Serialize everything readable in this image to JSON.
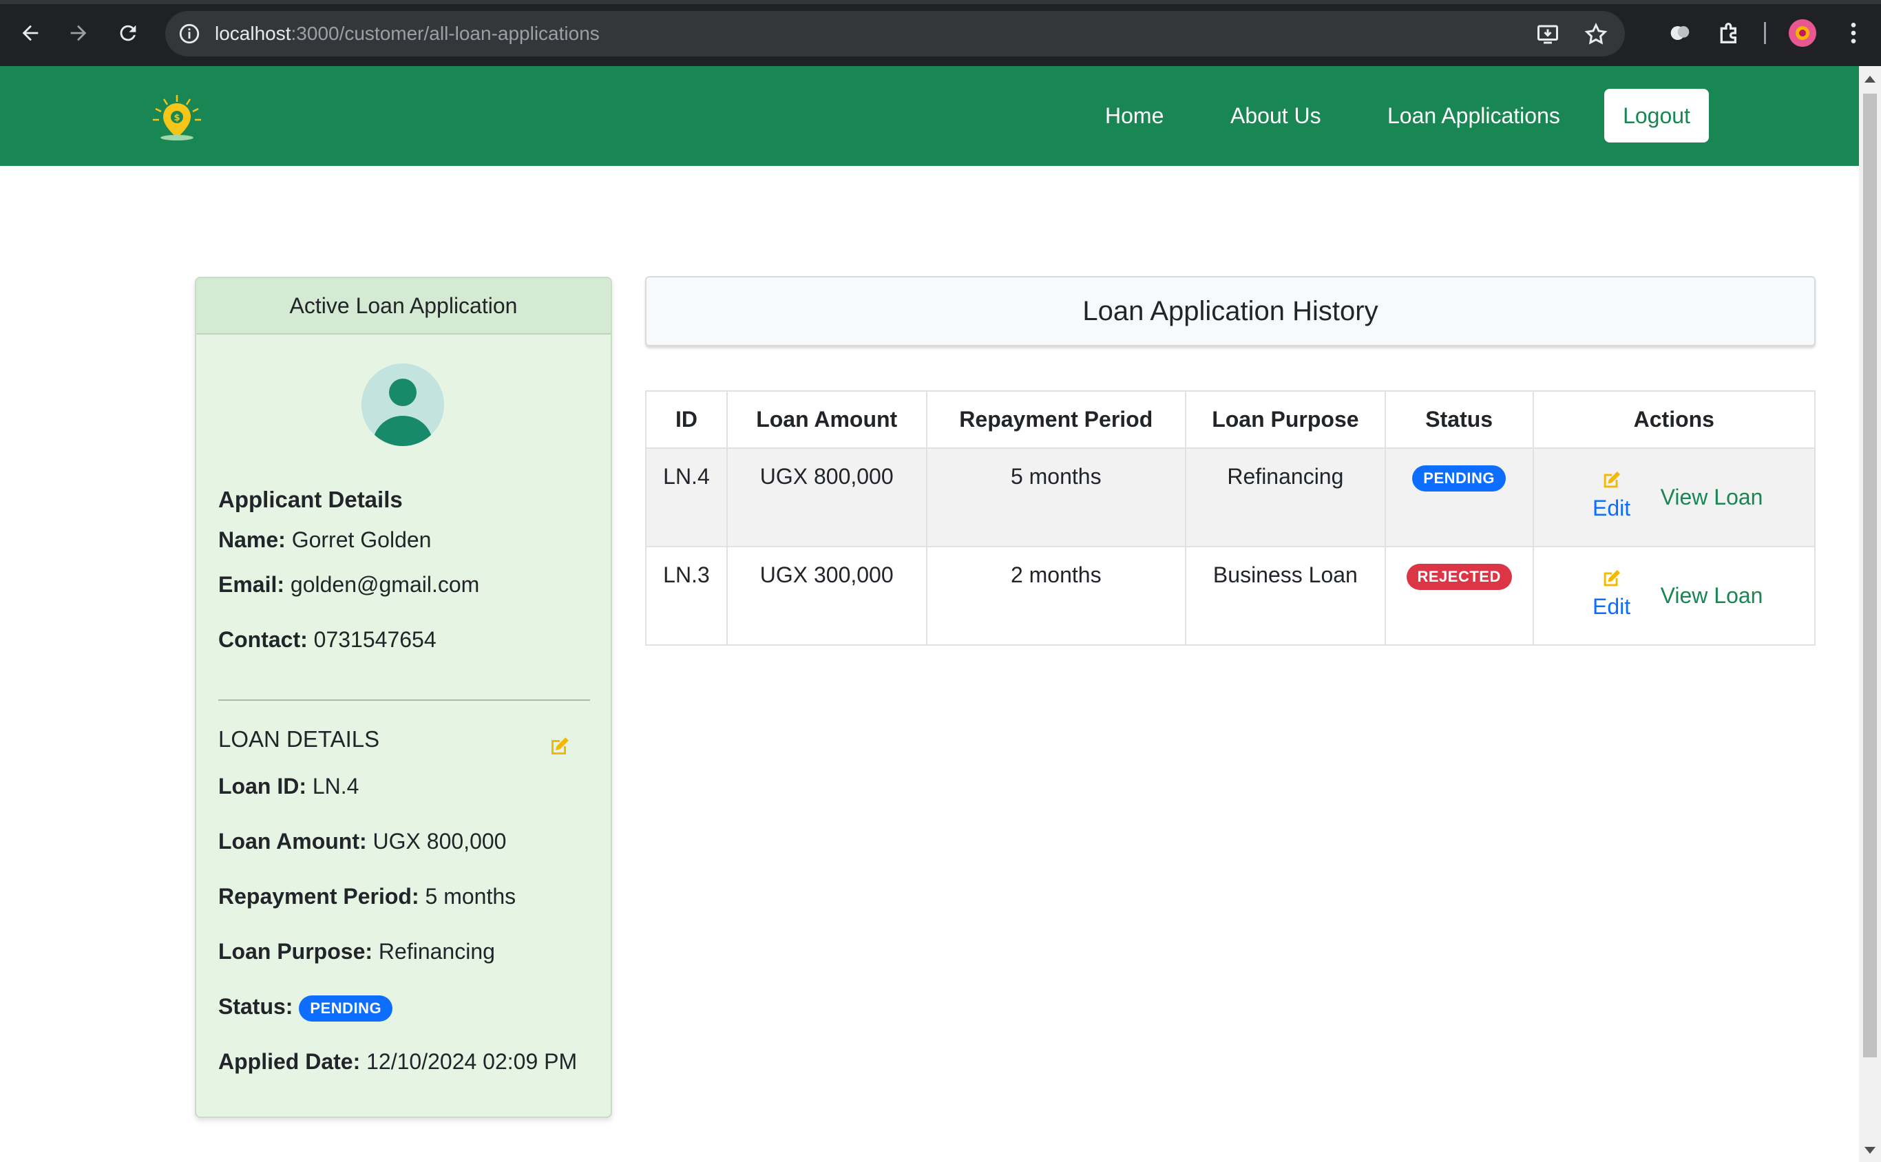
{
  "browser": {
    "url_host": "localhost",
    "url_path": ":3000/customer/all-loan-applications"
  },
  "navbar": {
    "links": [
      "Home",
      "About Us",
      "Loan Applications"
    ],
    "logout_label": "Logout",
    "bg_color": "#198754"
  },
  "active_card": {
    "header": "Active Loan Application",
    "applicant_heading": "Applicant Details",
    "name_label": "Name:",
    "name_value": "Gorret Golden",
    "email_label": "Email:",
    "email_value": "golden@gmail.com",
    "contact_label": "Contact:",
    "contact_value": "0731547654",
    "loan_heading": "LOAN DETAILS",
    "loan_id_label": "Loan ID:",
    "loan_id_value": "LN.4",
    "amount_label": "Loan Amount:",
    "amount_value": "UGX 800,000",
    "period_label": "Repayment Period:",
    "period_value": "5 months",
    "purpose_label": "Loan Purpose:",
    "purpose_value": "Refinancing",
    "status_label": "Status:",
    "status_value": "PENDING",
    "date_label": "Applied Date:",
    "date_value": "12/10/2024 02:09 PM"
  },
  "history": {
    "title": "Loan Application History",
    "columns": [
      "ID",
      "Loan Amount",
      "Repayment Period",
      "Loan Purpose",
      "Status",
      "Actions"
    ],
    "rows": [
      {
        "id": "LN.4",
        "amount": "UGX 800,000",
        "period": "5 months",
        "purpose": "Refinancing",
        "status": "PENDING",
        "edit": "Edit",
        "view": "View Loan"
      },
      {
        "id": "LN.3",
        "amount": "UGX 300,000",
        "period": "2 months",
        "purpose": "Business Loan",
        "status": "REJECTED",
        "edit": "Edit",
        "view": "View Loan"
      }
    ]
  }
}
